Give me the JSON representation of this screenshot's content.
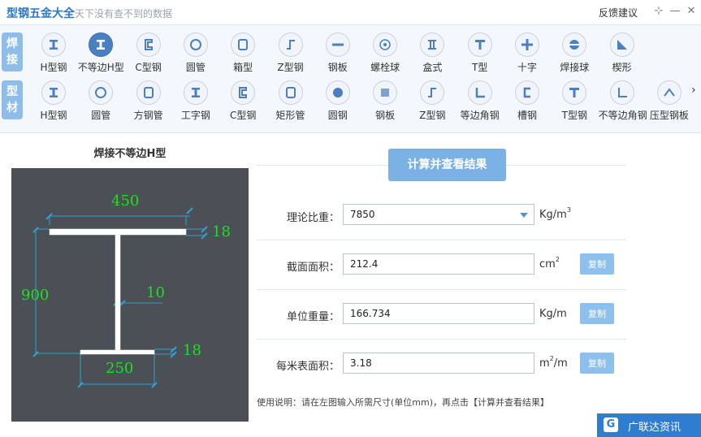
{
  "app": {
    "title": "型钢五金大全",
    "slogan": "天下没有查不到的数据",
    "feedback": "反馈建议",
    "win_pin": "⊹",
    "win_min": "—",
    "win_close": "✕"
  },
  "toolbar": {
    "row1_category": [
      "焊",
      "接"
    ],
    "row2_category": [
      "型",
      "材"
    ],
    "row1_tools": [
      {
        "label": "H型钢"
      },
      {
        "label": "不等边H型"
      },
      {
        "label": "C型钢"
      },
      {
        "label": "圆管"
      },
      {
        "label": "箱型"
      },
      {
        "label": "Z型钢"
      },
      {
        "label": "钢板"
      },
      {
        "label": "螺栓球"
      },
      {
        "label": "盒式"
      },
      {
        "label": "T型"
      },
      {
        "label": "十字"
      },
      {
        "label": "焊接球"
      },
      {
        "label": "楔形"
      }
    ],
    "row2_tools": [
      {
        "label": "H型钢"
      },
      {
        "label": "圆管"
      },
      {
        "label": "方钢管"
      },
      {
        "label": "工字钢"
      },
      {
        "label": "C型钢"
      },
      {
        "label": "矩形管"
      },
      {
        "label": "圆钢"
      },
      {
        "label": "钢板"
      },
      {
        "label": "Z型钢"
      },
      {
        "label": "等边角钢"
      },
      {
        "label": "槽钢"
      },
      {
        "label": "T型钢"
      },
      {
        "label": "不等边角钢"
      },
      {
        "label": "压型钢板"
      }
    ],
    "next_arrow": "›"
  },
  "diagram": {
    "title": "焊接不等边H型",
    "top_flange_width": "450",
    "top_flange_thickness": "18",
    "height": "900",
    "web_thickness": "10",
    "bottom_flange_width": "250",
    "bottom_flange_thickness": "18"
  },
  "form": {
    "compute_button": "计算并查看结果",
    "density": {
      "label": "理论比重：",
      "value": "7850",
      "unit_base": "Kg/m",
      "unit_sup": "3"
    },
    "area": {
      "label": "截面面积：",
      "value": "212.4",
      "unit_base": "cm",
      "unit_sup": "2",
      "copy": "复制"
    },
    "unit_weight": {
      "label": "单位重量：",
      "value": "166.734",
      "unit_base": "Kg/m",
      "copy": "复制"
    },
    "surface_area": {
      "label": "每米表面积：",
      "value": "3.18",
      "unit_base": "m",
      "unit_sup": "2",
      "unit_tail": "/m",
      "copy": "复制"
    },
    "usage": "使用说明：请在左图输入所需尺寸(单位mm)，再点击【计算并查看结果】"
  },
  "brand": {
    "logo": "G",
    "text": "广联达资讯"
  },
  "colors": {
    "accent": "#4a7fc1",
    "button": "#7ab2e6",
    "dim_text": "#22dd22",
    "diagram_bg": "#4b4f56"
  }
}
